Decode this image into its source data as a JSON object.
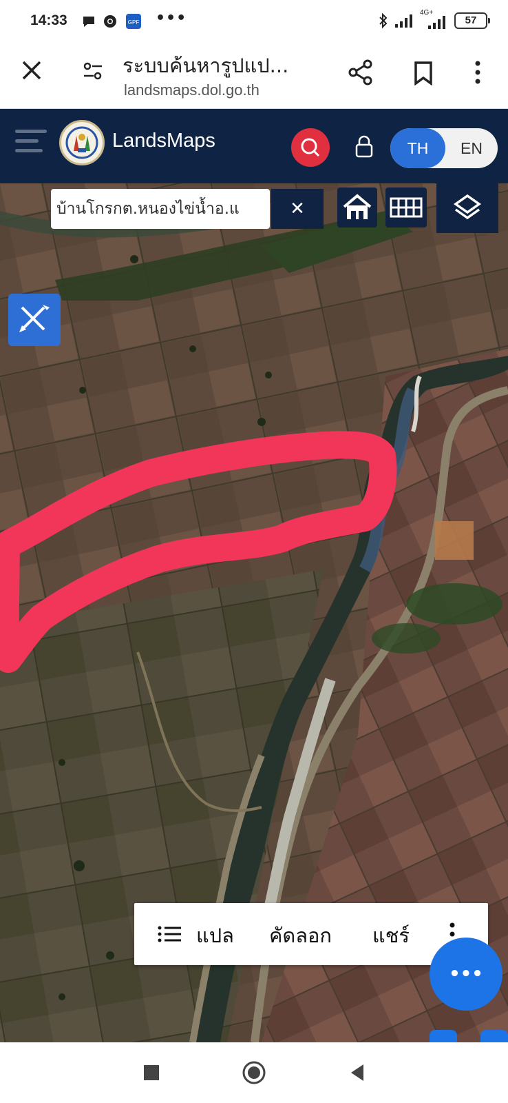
{
  "status_bar": {
    "time": "14:33",
    "icons": [
      "chat-bubble-icon",
      "chrome-icon",
      "gpf-app-icon",
      "bluetooth-icon",
      "signal-icon",
      "4g-signal-icon"
    ],
    "more": "•••",
    "network_label": "4G+",
    "battery": "57"
  },
  "browser": {
    "title": "ระบบค้นหารูปแป...",
    "url": "landsmaps.dol.go.th"
  },
  "app": {
    "brand": "LandsMaps",
    "lang_th": "TH",
    "lang_en": "EN",
    "accent": "#2b6fd8",
    "search_color": "#e0303f",
    "header_color": "#0f2444"
  },
  "map": {
    "search_value": "บ้านโกรกต.หนองไข่น้ำอ.แ",
    "clear_symbol": "✕",
    "highlight_color": "#f2365a"
  },
  "bottom_menu": {
    "items": [
      "แปล",
      "คัดลอก",
      "แชร์"
    ]
  },
  "fab": {
    "label": "•••"
  }
}
